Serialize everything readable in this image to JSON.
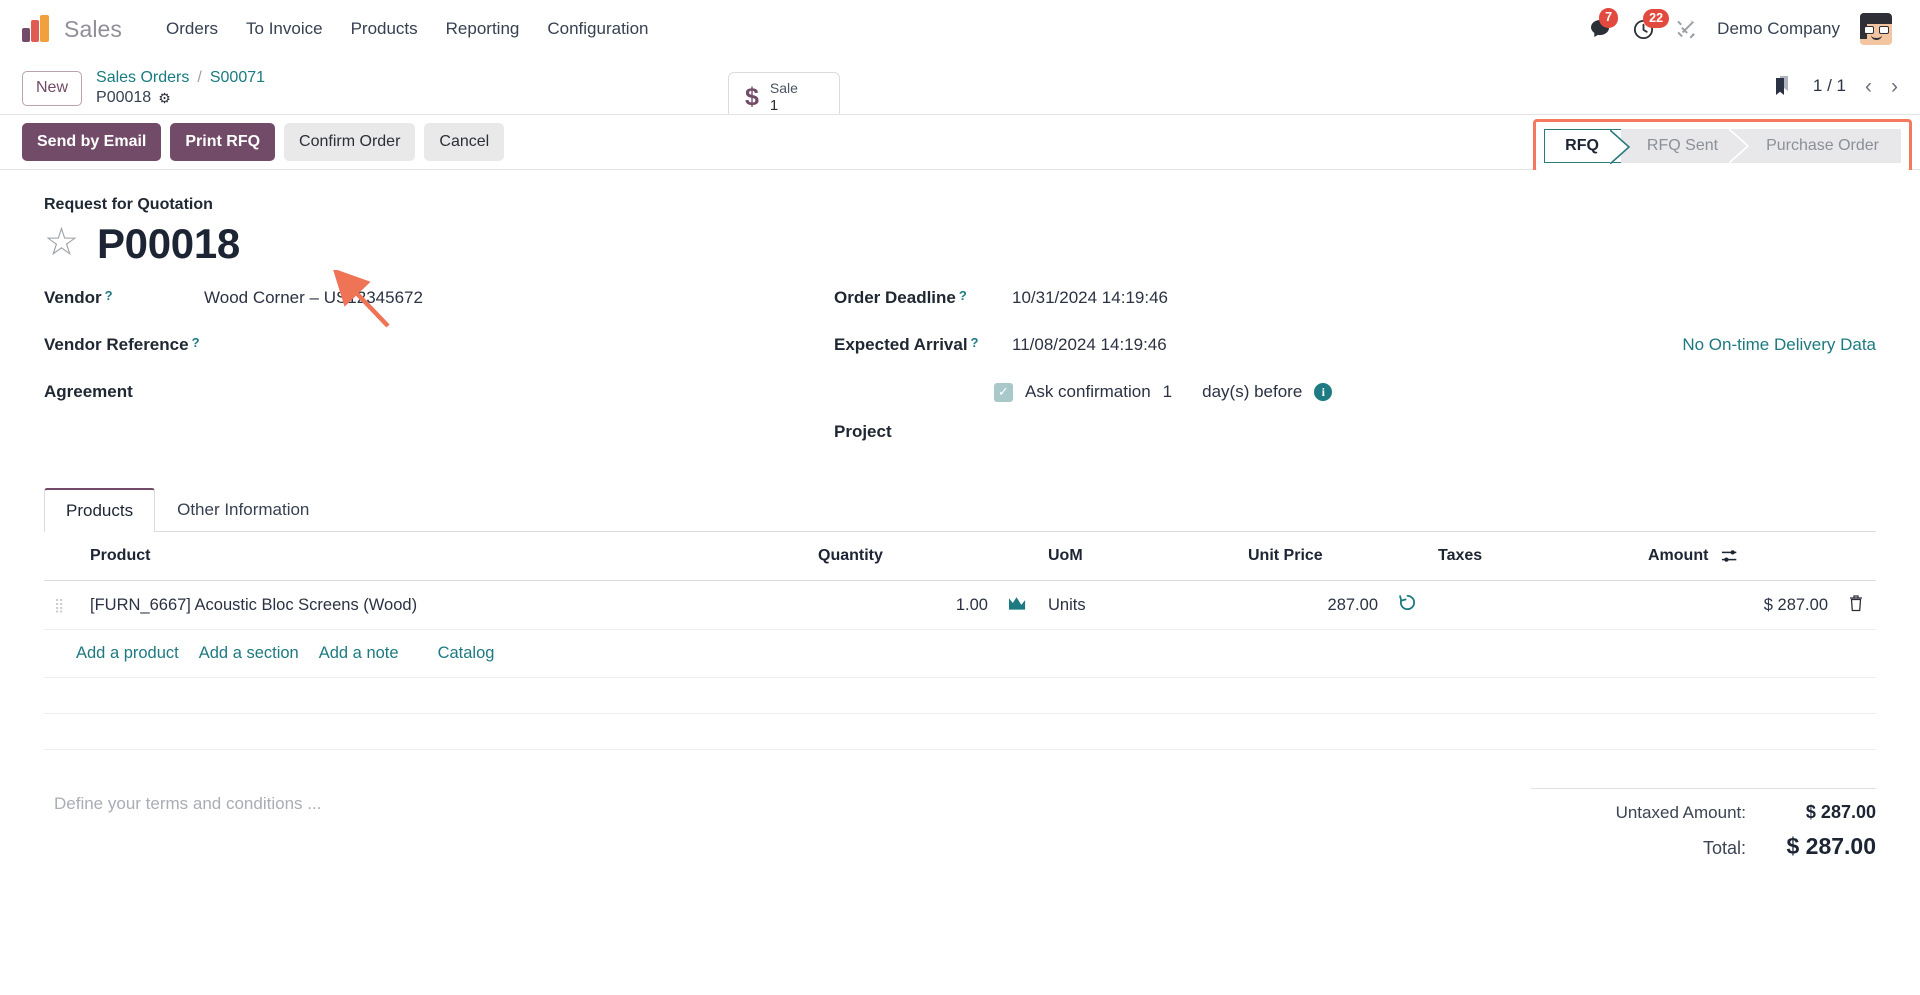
{
  "navbar": {
    "brand": "Sales",
    "menu": [
      "Orders",
      "To Invoice",
      "Products",
      "Reporting",
      "Configuration"
    ],
    "messages_count": "7",
    "activities_count": "22",
    "company": "Demo Company",
    "icons": {
      "messages": "chat-icon",
      "activities": "clock-icon",
      "debug": "tools-icon",
      "avatar": "user-avatar"
    }
  },
  "control_panel": {
    "new_button": "New",
    "breadcrumb_parent": "Sales Orders",
    "breadcrumb_separator": "/",
    "breadcrumb_second": "S00071",
    "breadcrumb_record": "P00018",
    "smart_button": {
      "icon": "$",
      "label": "Sale",
      "value": "1"
    },
    "pager": {
      "count": "1 / 1",
      "prev": "‹",
      "next": "›"
    }
  },
  "action_bar": {
    "buttons": [
      {
        "label": "Send by Email",
        "style": "primary"
      },
      {
        "label": "Print RFQ",
        "style": "primary"
      },
      {
        "label": "Confirm Order",
        "style": "secondary"
      },
      {
        "label": "Cancel",
        "style": "secondary"
      }
    ],
    "statusbar": [
      {
        "label": "RFQ",
        "active": true
      },
      {
        "label": "RFQ Sent",
        "active": false
      },
      {
        "label": "Purchase Order",
        "active": false
      }
    ],
    "highlight_color": "#f4795f"
  },
  "form": {
    "subtitle": "Request for Quotation",
    "record_name": "P00018",
    "left_fields": [
      {
        "label": "Vendor",
        "help": "?",
        "value": "Wood Corner – US12345672"
      },
      {
        "label": "Vendor Reference",
        "help": "?",
        "value": ""
      },
      {
        "label": "Agreement",
        "help": "",
        "value": ""
      }
    ],
    "right_fields": [
      {
        "label": "Order Deadline",
        "help": "?",
        "value": "10/31/2024 14:19:46"
      },
      {
        "label": "Expected Arrival",
        "help": "?",
        "value": "11/08/2024 14:19:46"
      },
      {
        "label": "Project",
        "help": "",
        "value": ""
      }
    ],
    "ontime_link": "No On-time Delivery Data",
    "confirmation": {
      "checked": true,
      "text_before": "Ask confirmation",
      "days": "1",
      "text_after": "day(s) before"
    }
  },
  "notebook": {
    "tabs": [
      {
        "label": "Products",
        "active": true
      },
      {
        "label": "Other Information",
        "active": false
      }
    ],
    "columns": [
      "Product",
      "Quantity",
      "UoM",
      "Unit Price",
      "Taxes",
      "Amount"
    ],
    "rows": [
      {
        "product": "[FURN_6667] Acoustic Bloc Screens (Wood)",
        "quantity": "1.00",
        "uom": "Units",
        "unit_price": "287.00",
        "taxes": "",
        "amount": "$ 287.00"
      }
    ],
    "add_links": [
      "Add a product",
      "Add a section",
      "Add a note",
      "Catalog"
    ]
  },
  "footer": {
    "terms_placeholder": "Define your terms and conditions ...",
    "totals": [
      {
        "label": "Untaxed Amount:",
        "value": "$ 287.00"
      },
      {
        "label": "Total:",
        "value": "$ 287.00"
      }
    ]
  }
}
